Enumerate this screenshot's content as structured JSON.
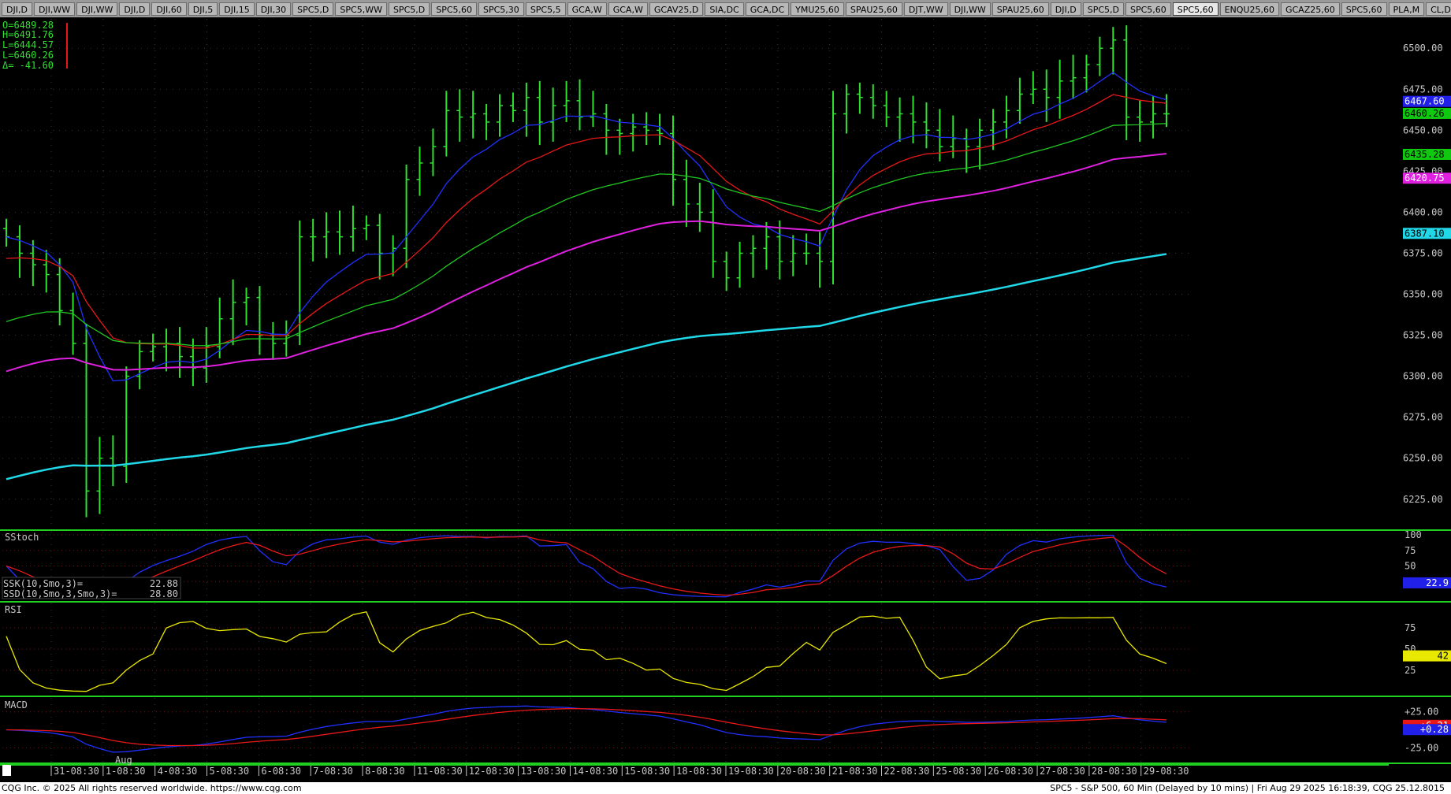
{
  "tabs": [
    "DJI,D",
    "DJI,WW",
    "DJI,WW",
    "DJI,D",
    "DJI,60",
    "DJI,5",
    "DJI,15",
    "DJI,30",
    "SPC5,D",
    "SPC5,WW",
    "SPC5,D",
    "SPC5,60",
    "SPC5,30",
    "SPC5,5",
    "GCA,W",
    "GCA,W",
    "GCAV25,D",
    "SIA,DC",
    "GCA,DC",
    "YMU25,60",
    "SPAU25,60",
    "DJT,WW",
    "DJI,WW",
    "SPAU25,60",
    "DJI,D",
    "SPC5,D",
    "SPC5,60",
    "SPC5,60",
    "ENQU25,60",
    "GCAZ25,60",
    "SPC5,60",
    "PLA,M",
    "CL,DC",
    "SPC5,MM",
    "+"
  ],
  "active_tab": 27,
  "ohlc": {
    "open": "O=6489.28",
    "high": "H=6491.76",
    "low": "L=6444.57",
    "last": "L=6460.26",
    "delta": "Δ=  -41.60"
  },
  "price_axis": [
    "6500.00",
    "6475.00",
    "6450.00",
    "6425.00",
    "6400.00",
    "6375.00",
    "6350.00",
    "6325.00",
    "6300.00",
    "6275.00",
    "6250.00",
    "6225.00"
  ],
  "price_labels": [
    {
      "text": "6467.60",
      "bg": "#2020e8",
      "fg": "#ffffff",
      "value": 6467.6
    },
    {
      "text": "6460.26",
      "bg": "#10c810",
      "fg": "#000000",
      "value": 6460.26
    },
    {
      "text": "6435.28",
      "bg": "#10c810",
      "fg": "#000000",
      "value": 6435.28
    },
    {
      "text": "6420.75",
      "bg": "#e020e0",
      "fg": "#ffffff",
      "value": 6420.75
    },
    {
      "text": "6387.10",
      "bg": "#20d8e8",
      "fg": "#000000",
      "value": 6387.1
    }
  ],
  "stoch": {
    "title": "SStoch",
    "ssk_label": "SSK(10,Smo,3)=",
    "ssk_value": "22.88",
    "ssd_label": "SSD(10,Smo,3,Smo,3)=",
    "ssd_value": "28.80",
    "axis": [
      "100",
      "75",
      "50",
      "25"
    ],
    "last": "22.9"
  },
  "rsi": {
    "title": "RSI",
    "axis": [
      "75",
      "50",
      "25"
    ],
    "last": "42"
  },
  "macd": {
    "title": "MACD",
    "axis": [
      "+25.00",
      "-25.00"
    ],
    "last1": "+6.21",
    "last2": "+0.28"
  },
  "time_axis": {
    "labels": [
      "31-08:30",
      "1-08:30",
      "4-08:30",
      "5-08:30",
      "6-08:30",
      "7-08:30",
      "8-08:30",
      "11-08:30",
      "12-08:30",
      "13-08:30",
      "14-08:30",
      "15-08:30",
      "18-08:30",
      "19-08:30",
      "20-08:30",
      "21-08:30",
      "22-08:30",
      "25-08:30",
      "26-08:30",
      "27-08:30",
      "28-08:30",
      "29-08:30"
    ],
    "month": "Aug"
  },
  "colors": {
    "bars": "#30e030",
    "ma_blue": "#2030ff",
    "ma_red": "#e81818",
    "ma_green": "#20c820",
    "ma_magenta": "#e020e0",
    "ma_cyan": "#20d8e8",
    "rsi": "#e8e800",
    "panel_border": "#20d020"
  },
  "footer": {
    "left": "CQG Inc. © 2025 All rights reserved worldwide. https://www.cqg.com",
    "right": "SPC5 - S&P 500, 60 Min (Delayed by 10 mins) | Fri Aug 29 2025 16:18:39, CQG 25.12.8015"
  },
  "chart_data": {
    "type": "ohlc",
    "symbol": "SPC5",
    "interval": "60 Min",
    "ylim": [
      6210,
      6515
    ],
    "day_labels": [
      "31-08:30",
      "1-08:30",
      "4-08:30",
      "5-08:30",
      "6-08:30",
      "7-08:30",
      "8-08:30",
      "11-08:30",
      "12-08:30",
      "13-08:30",
      "14-08:30",
      "15-08:30",
      "18-08:30",
      "19-08:30",
      "20-08:30",
      "21-08:30",
      "22-08:30",
      "25-08:30",
      "26-08:30",
      "27-08:30",
      "28-08:30",
      "29-08:30"
    ],
    "close_approx": [
      6385,
      6375,
      6368,
      6362,
      6340,
      6320,
      6230,
      6250,
      6245,
      6300,
      6315,
      6318,
      6320,
      6312,
      6305,
      6318,
      6335,
      6345,
      6348,
      6325,
      6320,
      6325,
      6385,
      6385,
      6388,
      6385,
      6390,
      6392,
      6375,
      6378,
      6420,
      6430,
      6440,
      6462,
      6458,
      6460,
      6455,
      6465,
      6462,
      6470,
      6455,
      6465,
      6468,
      6458,
      6460,
      6450,
      6448,
      6452,
      6450,
      6448,
      6420,
      6405,
      6400,
      6370,
      6360,
      6375,
      6378,
      6385,
      6370,
      6375,
      6375,
      6370,
      6460,
      6472,
      6470,
      6465,
      6458,
      6460,
      6455,
      6450,
      6440,
      6445,
      6440,
      6450,
      6455,
      6462,
      6472,
      6475,
      6470,
      6480,
      6482,
      6490,
      6500,
      6505,
      6458,
      6455,
      6460,
      6460
    ],
    "moving_averages": [
      {
        "name": "MA blue",
        "last": 6467.6
      },
      {
        "name": "MA green",
        "last": 6435.28
      },
      {
        "name": "MA magenta",
        "last": 6420.75
      },
      {
        "name": "MA cyan",
        "last": 6387.1
      }
    ],
    "sstoch": {
      "ssk": 22.88,
      "ssd": 28.8
    },
    "rsi_last": 42,
    "macd_last": [
      6.21,
      0.28
    ]
  }
}
